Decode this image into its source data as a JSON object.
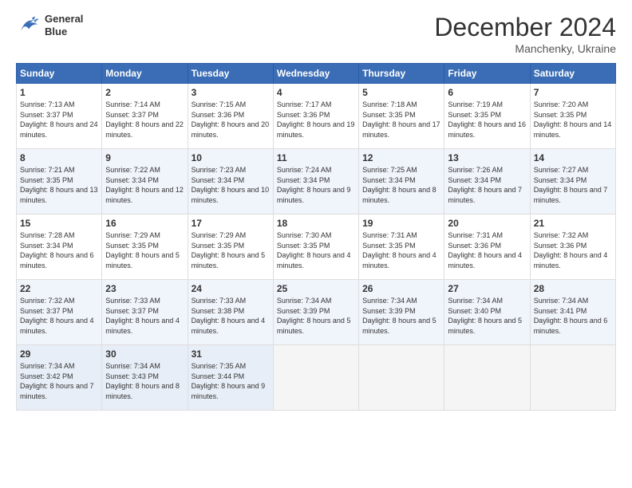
{
  "header": {
    "logo_line1": "General",
    "logo_line2": "Blue",
    "month": "December 2024",
    "location": "Manchenky, Ukraine"
  },
  "weekdays": [
    "Sunday",
    "Monday",
    "Tuesday",
    "Wednesday",
    "Thursday",
    "Friday",
    "Saturday"
  ],
  "weeks": [
    [
      {
        "day": 1,
        "sunrise": "7:13 AM",
        "sunset": "3:37 PM",
        "daylight": "8 hours and 24 minutes."
      },
      {
        "day": 2,
        "sunrise": "7:14 AM",
        "sunset": "3:37 PM",
        "daylight": "8 hours and 22 minutes."
      },
      {
        "day": 3,
        "sunrise": "7:15 AM",
        "sunset": "3:36 PM",
        "daylight": "8 hours and 20 minutes."
      },
      {
        "day": 4,
        "sunrise": "7:17 AM",
        "sunset": "3:36 PM",
        "daylight": "8 hours and 19 minutes."
      },
      {
        "day": 5,
        "sunrise": "7:18 AM",
        "sunset": "3:35 PM",
        "daylight": "8 hours and 17 minutes."
      },
      {
        "day": 6,
        "sunrise": "7:19 AM",
        "sunset": "3:35 PM",
        "daylight": "8 hours and 16 minutes."
      },
      {
        "day": 7,
        "sunrise": "7:20 AM",
        "sunset": "3:35 PM",
        "daylight": "8 hours and 14 minutes."
      }
    ],
    [
      {
        "day": 8,
        "sunrise": "7:21 AM",
        "sunset": "3:35 PM",
        "daylight": "8 hours and 13 minutes."
      },
      {
        "day": 9,
        "sunrise": "7:22 AM",
        "sunset": "3:34 PM",
        "daylight": "8 hours and 12 minutes."
      },
      {
        "day": 10,
        "sunrise": "7:23 AM",
        "sunset": "3:34 PM",
        "daylight": "8 hours and 10 minutes."
      },
      {
        "day": 11,
        "sunrise": "7:24 AM",
        "sunset": "3:34 PM",
        "daylight": "8 hours and 9 minutes."
      },
      {
        "day": 12,
        "sunrise": "7:25 AM",
        "sunset": "3:34 PM",
        "daylight": "8 hours and 8 minutes."
      },
      {
        "day": 13,
        "sunrise": "7:26 AM",
        "sunset": "3:34 PM",
        "daylight": "8 hours and 7 minutes."
      },
      {
        "day": 14,
        "sunrise": "7:27 AM",
        "sunset": "3:34 PM",
        "daylight": "8 hours and 7 minutes."
      }
    ],
    [
      {
        "day": 15,
        "sunrise": "7:28 AM",
        "sunset": "3:34 PM",
        "daylight": "8 hours and 6 minutes."
      },
      {
        "day": 16,
        "sunrise": "7:29 AM",
        "sunset": "3:35 PM",
        "daylight": "8 hours and 5 minutes."
      },
      {
        "day": 17,
        "sunrise": "7:29 AM",
        "sunset": "3:35 PM",
        "daylight": "8 hours and 5 minutes."
      },
      {
        "day": 18,
        "sunrise": "7:30 AM",
        "sunset": "3:35 PM",
        "daylight": "8 hours and 4 minutes."
      },
      {
        "day": 19,
        "sunrise": "7:31 AM",
        "sunset": "3:35 PM",
        "daylight": "8 hours and 4 minutes."
      },
      {
        "day": 20,
        "sunrise": "7:31 AM",
        "sunset": "3:36 PM",
        "daylight": "8 hours and 4 minutes."
      },
      {
        "day": 21,
        "sunrise": "7:32 AM",
        "sunset": "3:36 PM",
        "daylight": "8 hours and 4 minutes."
      }
    ],
    [
      {
        "day": 22,
        "sunrise": "7:32 AM",
        "sunset": "3:37 PM",
        "daylight": "8 hours and 4 minutes."
      },
      {
        "day": 23,
        "sunrise": "7:33 AM",
        "sunset": "3:37 PM",
        "daylight": "8 hours and 4 minutes."
      },
      {
        "day": 24,
        "sunrise": "7:33 AM",
        "sunset": "3:38 PM",
        "daylight": "8 hours and 4 minutes."
      },
      {
        "day": 25,
        "sunrise": "7:34 AM",
        "sunset": "3:39 PM",
        "daylight": "8 hours and 5 minutes."
      },
      {
        "day": 26,
        "sunrise": "7:34 AM",
        "sunset": "3:39 PM",
        "daylight": "8 hours and 5 minutes."
      },
      {
        "day": 27,
        "sunrise": "7:34 AM",
        "sunset": "3:40 PM",
        "daylight": "8 hours and 5 minutes."
      },
      {
        "day": 28,
        "sunrise": "7:34 AM",
        "sunset": "3:41 PM",
        "daylight": "8 hours and 6 minutes."
      }
    ],
    [
      {
        "day": 29,
        "sunrise": "7:34 AM",
        "sunset": "3:42 PM",
        "daylight": "8 hours and 7 minutes."
      },
      {
        "day": 30,
        "sunrise": "7:34 AM",
        "sunset": "3:43 PM",
        "daylight": "8 hours and 8 minutes."
      },
      {
        "day": 31,
        "sunrise": "7:35 AM",
        "sunset": "3:44 PM",
        "daylight": "8 hours and 9 minutes."
      },
      null,
      null,
      null,
      null
    ]
  ],
  "labels": {
    "sunrise": "Sunrise:",
    "sunset": "Sunset:",
    "daylight": "Daylight:"
  }
}
